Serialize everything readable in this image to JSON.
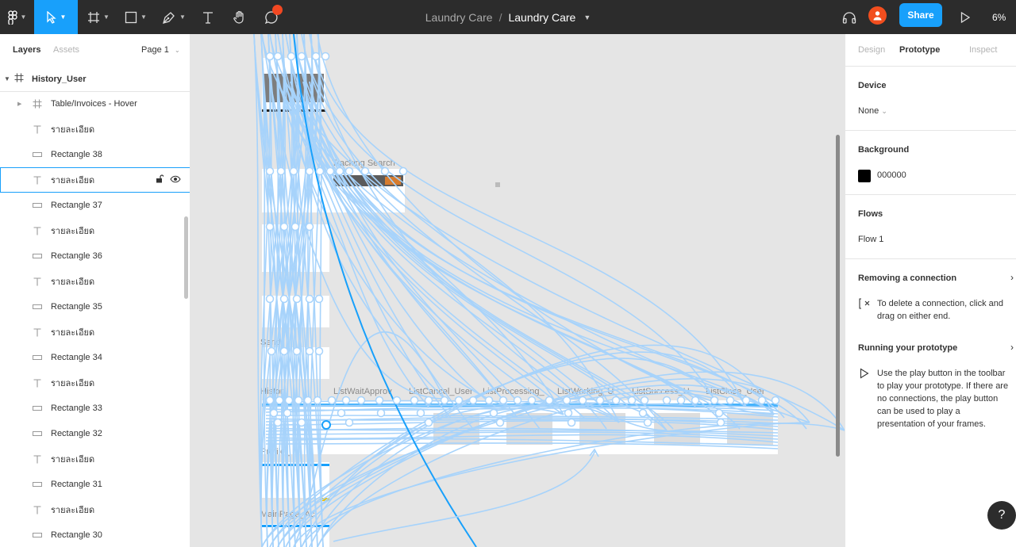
{
  "toolbar": {
    "project": "Laundry Care",
    "separator": "/",
    "file_name": "Laundry Care",
    "share_label": "Share",
    "zoom": "6%",
    "tools": [
      "figma-menu-icon",
      "move-icon",
      "frame-icon",
      "shape-icon",
      "pen-icon",
      "text-icon",
      "hand-icon",
      "comment-icon"
    ]
  },
  "left_panel": {
    "tabs": [
      {
        "label": "Layers"
      },
      {
        "label": "Assets"
      }
    ],
    "page": "Page 1",
    "root": "History_User",
    "layers": [
      {
        "label": "Table/Invoices - Hover",
        "type": "frame"
      },
      {
        "label": "รายละเอียด",
        "type": "text"
      },
      {
        "label": "Rectangle 38",
        "type": "rect"
      },
      {
        "label": "รายละเอียด",
        "type": "text"
      },
      {
        "label": "Rectangle 37",
        "type": "rect"
      },
      {
        "label": "รายละเอียด",
        "type": "text"
      },
      {
        "label": "Rectangle 36",
        "type": "rect"
      },
      {
        "label": "รายละเอียด",
        "type": "text"
      },
      {
        "label": "Rectangle 35",
        "type": "rect"
      },
      {
        "label": "รายละเอียด",
        "type": "text"
      },
      {
        "label": "Rectangle 34",
        "type": "rect"
      },
      {
        "label": "รายละเอียด",
        "type": "text"
      },
      {
        "label": "Rectangle 33",
        "type": "rect"
      },
      {
        "label": "Rectangle 32",
        "type": "rect"
      },
      {
        "label": "รายละเอียด",
        "type": "text"
      },
      {
        "label": "Rectangle 31",
        "type": "rect"
      },
      {
        "label": "รายละเอียด",
        "type": "text"
      },
      {
        "label": "Rectangle 30",
        "type": "rect"
      }
    ],
    "selected_index": 3
  },
  "canvas": {
    "frame_labels": [
      "Tracking Search",
      "Histor",
      "ListWaitApprov",
      "ListCancel_User",
      "ListProcessing_",
      "ListWorking_U",
      "ListSuccess_U",
      "ListClose_User",
      "Profile_",
      "MainPage_Ac",
      "Send"
    ]
  },
  "right_panel": {
    "tabs": [
      {
        "label": "Design"
      },
      {
        "label": "Prototype"
      },
      {
        "label": "Inspect"
      }
    ],
    "device_heading": "Device",
    "device_value": "None",
    "background_heading": "Background",
    "background_value": "000000",
    "background_color": "#000000",
    "flows_heading": "Flows",
    "flow_value": "Flow 1",
    "removing_heading": "Removing a connection",
    "removing_text": "To delete a connection, click and drag on either end.",
    "running_heading": "Running your prototype",
    "running_text": "Use the play button in the toolbar to play your prototype. If there are no connections, the play button can be used to play a presentation of your frames."
  },
  "help": "?"
}
